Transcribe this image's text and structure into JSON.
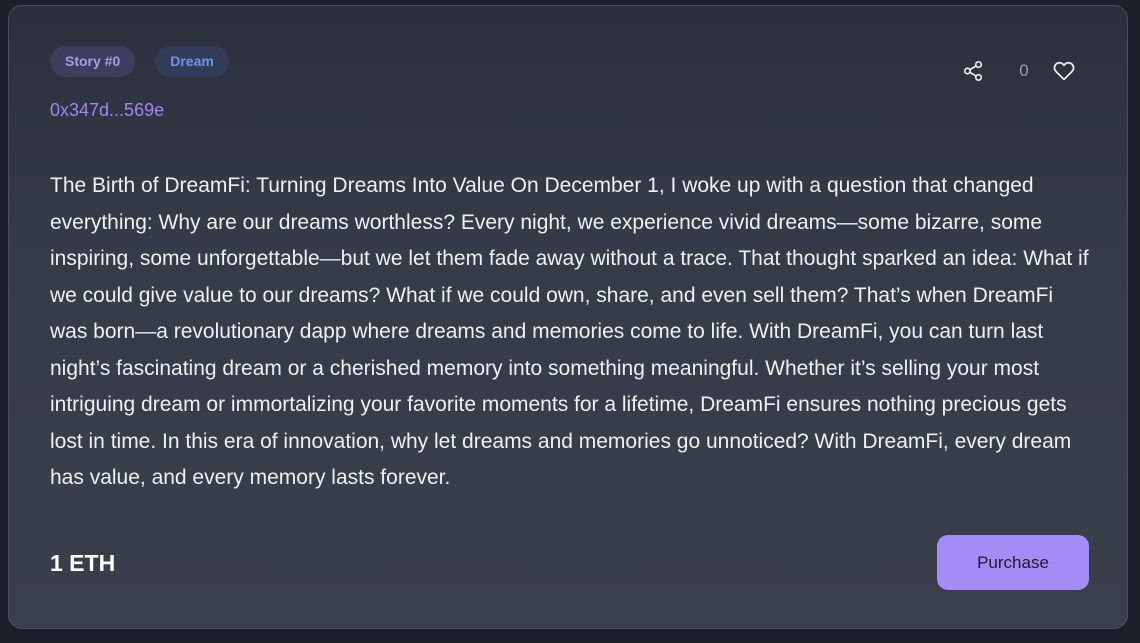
{
  "card": {
    "tags": {
      "story": "Story #0",
      "category": "Dream"
    },
    "address": "0x347d...569e",
    "actions": {
      "share_icon": "share-icon",
      "like_count": "0",
      "like_icon": "heart-icon"
    },
    "body": "The Birth of DreamFi: Turning Dreams Into Value On December 1, I woke up with a question that changed everything: Why are our dreams worthless? Every night, we experience vivid dreams—some bizarre, some inspiring, some unforgettable—but we let them fade away without a trace. That thought sparked an idea: What if we could give value to our dreams? What if we could own, share, and even sell them? That’s when DreamFi was born—a revolutionary dapp where dreams and memories come to life. With DreamFi, you can turn last night’s fascinating dream or a cherished memory into something meaningful. Whether it’s selling your most intriguing dream or immortalizing your favorite moments for a lifetime, DreamFi ensures nothing precious gets lost in time. In this era of innovation, why let dreams and memories go unnoticed? With DreamFi, every dream has value, and every memory lasts forever.",
    "price": "1 ETH",
    "purchase_label": "Purchase"
  },
  "colors": {
    "background": "#1d202a",
    "card": "#363b48",
    "accent": "#a48cf7",
    "address": "#a385f5",
    "story_tag": "#a99ee8",
    "dream_tag": "#6f95e6"
  }
}
